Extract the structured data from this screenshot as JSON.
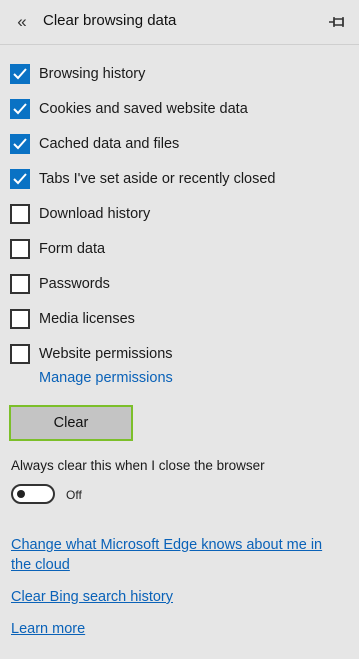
{
  "header": {
    "back_glyph": "«",
    "title": "Clear browsing data"
  },
  "options": [
    {
      "label": "Browsing history",
      "checked": true
    },
    {
      "label": "Cookies and saved website data",
      "checked": true
    },
    {
      "label": "Cached data and files",
      "checked": true
    },
    {
      "label": "Tabs I've set aside or recently closed",
      "checked": true
    },
    {
      "label": "Download history",
      "checked": false
    },
    {
      "label": "Form data",
      "checked": false
    },
    {
      "label": "Passwords",
      "checked": false
    },
    {
      "label": "Media licenses",
      "checked": false
    },
    {
      "label": "Website permissions",
      "checked": false
    }
  ],
  "manage_permissions": "Manage permissions",
  "clear_button": "Clear",
  "always_clear": {
    "label": "Always clear this when I close the browser",
    "state": "Off",
    "on": false
  },
  "links": {
    "edge_knows": "Change what Microsoft Edge knows about me in the cloud",
    "bing_history": "Clear Bing search history",
    "learn_more": "Learn more"
  },
  "colors": {
    "accent": "#0a72c4",
    "link": "#0a62b8",
    "clear_button_border": "#7cbf2a",
    "background": "#e6e6e6"
  },
  "icons": {
    "back": "double-chevron-left-icon",
    "pin": "pin-icon",
    "check": "checkmark-icon"
  }
}
